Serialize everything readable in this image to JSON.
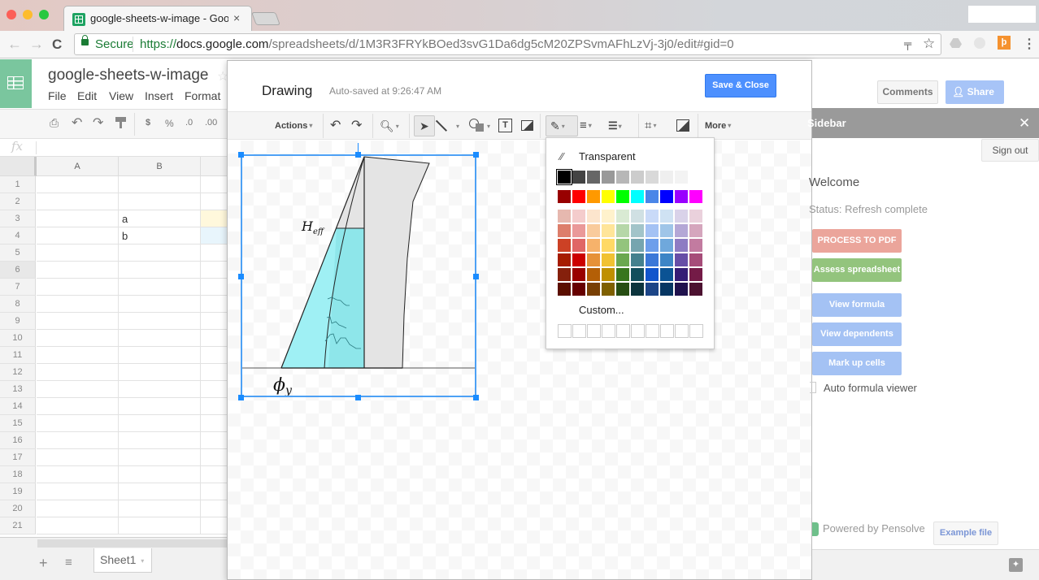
{
  "browser": {
    "tab_title": "google-sheets-w-image - Goo",
    "tab_close": "×",
    "url_secure_label": "Secure",
    "url_protocol": "https://",
    "url_host": "docs.google.com",
    "url_path": "/spreadsheets/d/1M3R3FRYkBOed3svG1Da6dg5cM20ZPSvmAFhLzVj-3j0/edit#gid=0",
    "icons": {
      "back": "←",
      "forward": "→",
      "reload": "C",
      "key": "🔑",
      "bookmark": "☆",
      "menu": "⋮"
    }
  },
  "sheets": {
    "doc_title": "google-sheets-w-image",
    "star": "☆",
    "menu": [
      "File",
      "Edit",
      "View",
      "Insert",
      "Format"
    ],
    "toolbar": {
      "print": "⎙",
      "undo": "↶",
      "redo": "↷",
      "paint": "🖌",
      "currency": "$",
      "percent": "%",
      "dec_decrease": ".0",
      "dec_increase": ".00"
    },
    "fx_label": "fx",
    "columns": [
      "A",
      "B"
    ],
    "rows": [
      "1",
      "2",
      "3",
      "4",
      "5",
      "6",
      "7",
      "8",
      "9",
      "10",
      "11",
      "12",
      "13",
      "14",
      "15",
      "16",
      "17",
      "18",
      "19",
      "20",
      "21"
    ],
    "cells": {
      "B3": "a",
      "B4": "b"
    },
    "sheet_tab": "Sheet1",
    "add_sheet": "+",
    "all_sheets": "≡"
  },
  "drawing": {
    "title": "Drawing",
    "autosave": "Auto-saved at 9:26:47 AM",
    "save_close": "Save & Close",
    "toolbar": {
      "actions": "Actions",
      "more": "More",
      "caret": "▾"
    },
    "image_labels": {
      "h_eff": "H",
      "h_eff_sub": "eff",
      "phi": "ϕ",
      "phi_sub": "y"
    },
    "palette": {
      "transparent_label": "Transparent",
      "custom_label": "Custom...",
      "grays": [
        "#000000",
        "#434343",
        "#666666",
        "#999999",
        "#b7b7b7",
        "#cccccc",
        "#d9d9d9",
        "#efefef",
        "#f3f3f3",
        "#ffffff"
      ],
      "brights": [
        "#980000",
        "#ff0000",
        "#ff9900",
        "#ffff00",
        "#00ff00",
        "#00ffff",
        "#4a86e8",
        "#0000ff",
        "#9900ff",
        "#ff00ff"
      ],
      "shades": [
        [
          "#e6b8af",
          "#f4cccc",
          "#fce5cd",
          "#fff2cc",
          "#d9ead3",
          "#d0e0e3",
          "#c9daf8",
          "#cfe2f3",
          "#d9d2e9",
          "#ead1dc"
        ],
        [
          "#dd7e6b",
          "#ea9999",
          "#f9cb9c",
          "#ffe599",
          "#b6d7a8",
          "#a2c4c9",
          "#a4c2f4",
          "#9fc5e8",
          "#b4a7d6",
          "#d5a6bd"
        ],
        [
          "#cc4125",
          "#e06666",
          "#f6b26b",
          "#ffd966",
          "#93c47d",
          "#76a5af",
          "#6d9eeb",
          "#6fa8dc",
          "#8e7cc3",
          "#c27ba0"
        ],
        [
          "#a61c00",
          "#cc0000",
          "#e69138",
          "#f1c232",
          "#6aa84f",
          "#45818e",
          "#3c78d8",
          "#3d85c6",
          "#674ea7",
          "#a64d79"
        ],
        [
          "#85200c",
          "#990000",
          "#b45f06",
          "#bf9000",
          "#38761d",
          "#134f5c",
          "#1155cc",
          "#0b5394",
          "#351c75",
          "#741b47"
        ],
        [
          "#5b0f00",
          "#660000",
          "#783f04",
          "#7f6000",
          "#274e13",
          "#0c343d",
          "#1c4587",
          "#073763",
          "#20124d",
          "#4c1130"
        ]
      ],
      "selected": "#000000"
    }
  },
  "right": {
    "comments": "Comments",
    "share": "Share",
    "sidebar_title": "Sidebar",
    "close": "✕",
    "sign_out": "Sign out",
    "welcome": "Welcome",
    "status": "Status: Refresh complete",
    "buttons": [
      {
        "label": "PROCESS TO PDF",
        "color": "#eba59b"
      },
      {
        "label": "Assess spreadsheet",
        "color": "#93c47d"
      },
      {
        "label": "View formula",
        "color": "#a4c2f4"
      },
      {
        "label": "View dependents",
        "color": "#a4c2f4"
      },
      {
        "label": "Mark up cells",
        "color": "#a4c2f4"
      }
    ],
    "auto_formula": "Auto formula viewer",
    "powered_by": "Powered by Pensolve",
    "example_file": "Example file",
    "explore": "✦"
  }
}
